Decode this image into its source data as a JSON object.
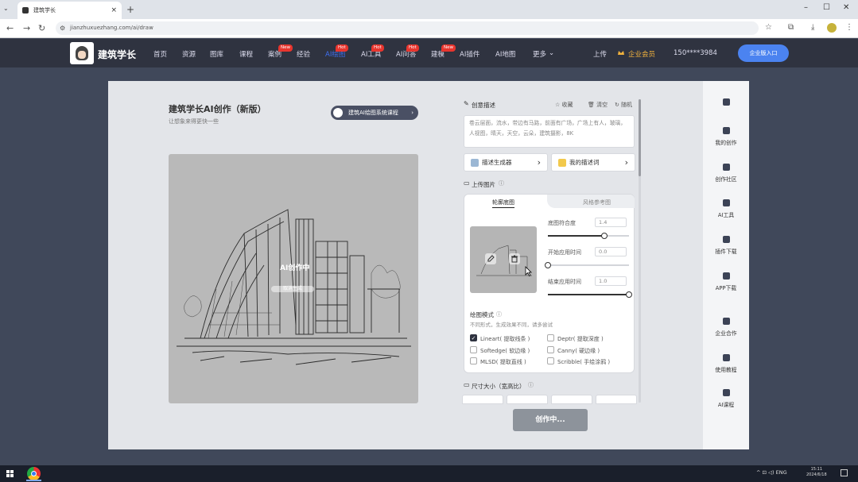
{
  "browser": {
    "tab_title": "建筑学长",
    "new_tab": "+",
    "url": "jianzhuxuezhang.com/ai/draw",
    "window_controls": [
      "–",
      "☐",
      "✕"
    ]
  },
  "header": {
    "brand": "建筑学长",
    "nav": [
      {
        "label": "首页"
      },
      {
        "label": "资源"
      },
      {
        "label": "图库"
      },
      {
        "label": "课程"
      },
      {
        "label": "案例",
        "badge": "New"
      },
      {
        "label": "经验"
      },
      {
        "label": "AI绘图",
        "badge": "Hot",
        "active": true
      },
      {
        "label": "AI工具",
        "badge": "Hot"
      },
      {
        "label": "AI问答",
        "badge": "Hot"
      },
      {
        "label": "建模",
        "badge": "New"
      },
      {
        "label": "AI插件"
      },
      {
        "label": "AI地图"
      },
      {
        "label": "更多"
      }
    ],
    "upload": "上传",
    "vip": "企业会员",
    "phone": "150****3984",
    "enterprise_button": "企业版入口"
  },
  "main": {
    "title": "建筑学长AI创作（新版）",
    "subtitle": "让想象来得更快一些",
    "course_button": "建筑AI绘图系统课程",
    "preview_status": "AI创作中",
    "preview_bar_label": "取消生成",
    "describe": {
      "label": "创意描述",
      "collect": "收藏",
      "clear": "清空",
      "random": "随机",
      "text": "卷云层面，流水，带边有马路，前面有广场，广场上有人，玻璃，人视图，晴天，天空，云朵，建筑摄影，8K",
      "generator_button": "描述生成器",
      "my_button": "我的描述词"
    },
    "upload_image": {
      "label": "上传图片",
      "tabs": [
        "轮廓底图",
        "风格参考图"
      ],
      "params": [
        {
          "label": "底图符合度",
          "value": "1.4",
          "fraction": 0.7
        },
        {
          "label": "开始应用时间",
          "value": "0.0",
          "fraction": 0.0
        },
        {
          "label": "结束应用时间",
          "value": "1.0",
          "fraction": 1.0
        }
      ],
      "mode_label": "绘图模式",
      "mode_hint": "不同形式，生成效果不同，请多尝试",
      "modes": [
        {
          "label": "Lineart( 提取线条 )",
          "checked": true
        },
        {
          "label": "Deptr( 提取深度 )",
          "checked": false
        },
        {
          "label": "Softedge( 软边缘 )",
          "checked": false
        },
        {
          "label": "Canny( 硬边缘 )",
          "checked": false
        },
        {
          "label": "MLSD( 提取直线 )",
          "checked": false
        },
        {
          "label": "Scribble( 手绘涂鸦 )",
          "checked": false
        }
      ]
    },
    "size_label": "尺寸大小（宽高比）",
    "generate_button": "创作中..."
  },
  "sidebar": {
    "items": [
      {
        "label": "",
        "icon": "grid-icon"
      },
      {
        "label": "我的创作",
        "icon": "palette-icon"
      },
      {
        "label": "创作社区",
        "icon": "chat-icon"
      },
      {
        "label": "AI工具",
        "icon": "toolbox-icon"
      },
      {
        "label": "插件下载",
        "icon": "puzzle-icon"
      },
      {
        "label": "APP下载",
        "icon": "app-icon"
      },
      {
        "label": "企业合作",
        "icon": "building-icon"
      },
      {
        "label": "使用教程",
        "icon": "book-icon"
      },
      {
        "label": "AI课程",
        "icon": "video-icon"
      }
    ]
  },
  "taskbar": {
    "tray": "^ ⊡ ◁) ENG",
    "time": "15:11",
    "date": "2024/6/18"
  },
  "colors": {
    "header_bg": "#2f3340",
    "accent": "#4b83f0",
    "badge": "#e8352e",
    "vip": "#f2b33d"
  }
}
